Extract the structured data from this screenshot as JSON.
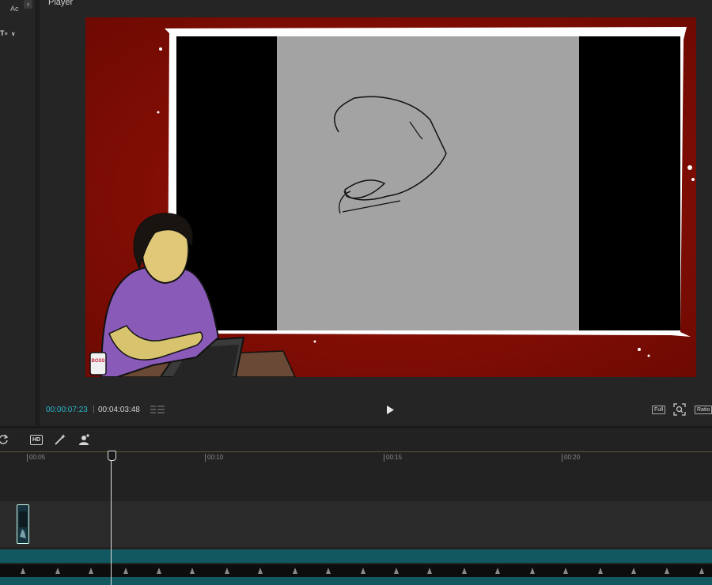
{
  "left_panel": {
    "tab_a": "Ac",
    "filter_label": "T",
    "filter_suffix": "∨"
  },
  "player": {
    "title": "Player",
    "time_current": "00:00:07:23",
    "time_separator": "|",
    "time_total": "00:04:03:48",
    "full_label": "Full",
    "ratio_label": "Ratio",
    "frame": {
      "mug_text": "BOSS"
    }
  },
  "timeline": {
    "ruler_ticks": [
      "00:05",
      "00:10",
      "00:15",
      "00:20"
    ],
    "toolbar_icons": [
      "refresh-icon",
      "hd-icon",
      "magic-wand-icon",
      "person-add-icon"
    ],
    "hd_label": "HD"
  },
  "colors": {
    "accent": "#28b5c9",
    "video_bg": "#8c0d04",
    "track_teal": "#125860"
  }
}
